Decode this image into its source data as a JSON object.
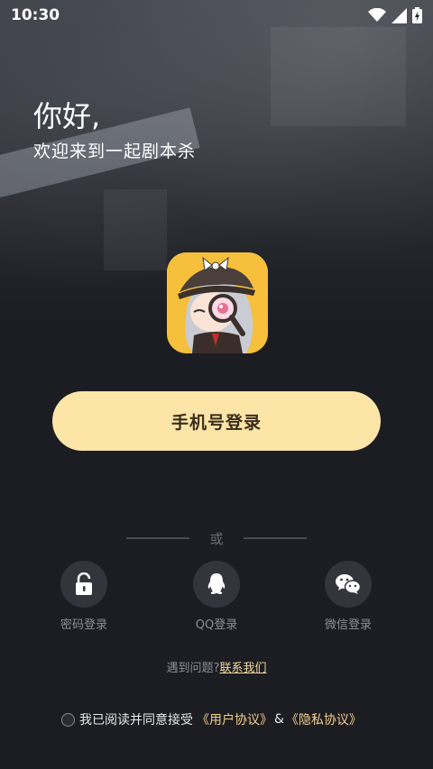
{
  "status_bar": {
    "time": "10:30"
  },
  "greeting": {
    "title": "你好,",
    "subtitle": "欢迎来到一起剧本杀"
  },
  "primary": {
    "phone_login_label": "手机号登录"
  },
  "divider": {
    "or_text": "或"
  },
  "login_options": [
    {
      "label": "密码登录",
      "icon": "lock-icon"
    },
    {
      "label": "QQ登录",
      "icon": "qq-icon"
    },
    {
      "label": "微信登录",
      "icon": "wechat-icon"
    }
  ],
  "help": {
    "text": "遇到问题?",
    "link": "联系我们"
  },
  "agreement": {
    "prefix": "我已阅读并同意接受",
    "user_agreement": "《用户协议》",
    "amp": "&",
    "privacy_policy": "《隐私协议》"
  },
  "colors": {
    "accent": "#fde5a8",
    "link": "#f3d8a0",
    "background": "#1c1d22"
  }
}
